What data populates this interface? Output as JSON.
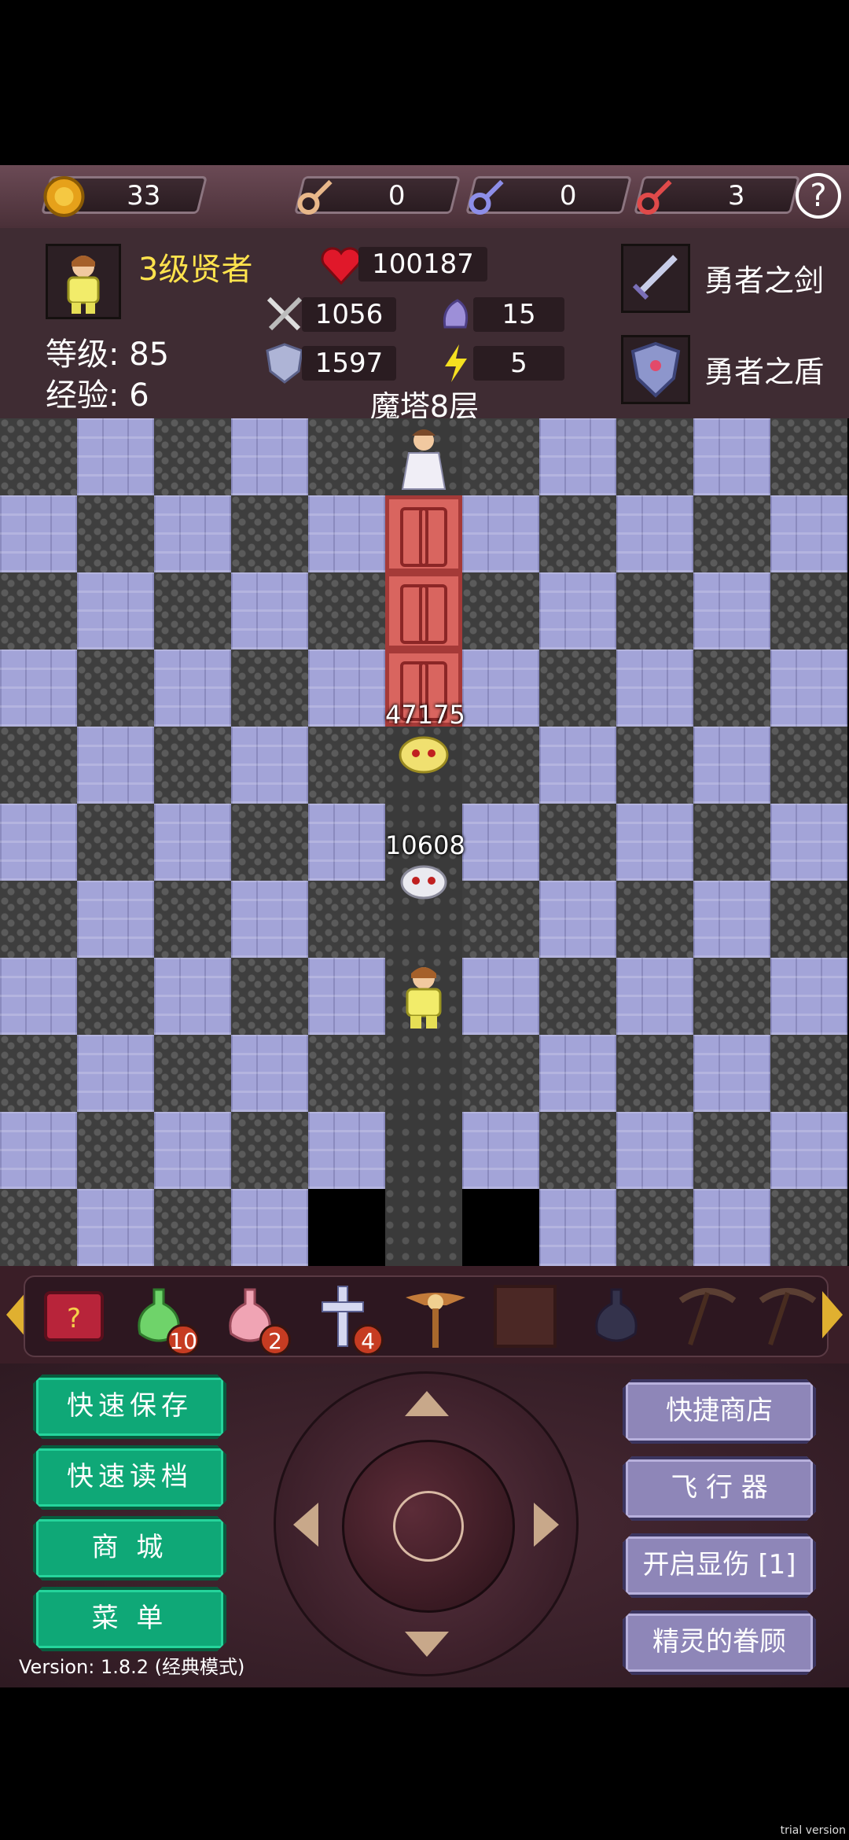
{
  "resources": {
    "gold": "33",
    "yellow_key": "0",
    "blue_key": "0",
    "red_key": "3",
    "help_label": "?"
  },
  "hero": {
    "title": "3级贤者",
    "level_label": "等级: 85",
    "exp_label": "经验: 6",
    "hp": "100187",
    "atk": "1056",
    "def": "1597",
    "mdef": "15",
    "agi": "5",
    "floor": "魔塔8层",
    "weapon": "勇者之剑",
    "shield": "勇者之盾"
  },
  "board": {
    "damage_labels": [
      "47175",
      "10608"
    ]
  },
  "items": {
    "badges": [
      "10",
      "2",
      "4"
    ]
  },
  "buttons": {
    "quick_save": "快速保存",
    "quick_load": "快速读档",
    "shop": "商 城",
    "menu": "菜 单",
    "quick_shop": "快捷商店",
    "flyer": "飞 行 器",
    "show_damage": "开启显伤 [1]",
    "fairy": "精灵的眷顾"
  },
  "version": "Version: 1.8.2 (经典模式)",
  "watermark": "trial version",
  "colors": {
    "accent_yellow": "#ffe34d",
    "green_button": "#0fa877",
    "purple_button": "#8e86b8"
  }
}
